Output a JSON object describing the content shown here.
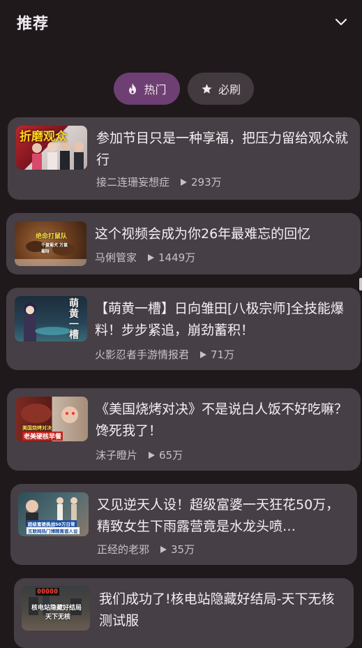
{
  "header": {
    "title": "推荐"
  },
  "tabs": [
    {
      "label": "热门",
      "icon": "flame-icon",
      "selected": true
    },
    {
      "label": "必刷",
      "icon": "star-icon",
      "selected": false
    }
  ],
  "videos": [
    {
      "title": "参加节目只是一种享福，把压力留给观众就行",
      "author": "接二连珊妄想症",
      "views": "293万",
      "thumb_text": "折磨观众"
    },
    {
      "title": "这个视频会成为你26年最难忘的回忆",
      "author": "马俐管家",
      "views": "1449万",
      "thumb_text": "绝命打鼠队",
      "thumb_sub": "千鼠蜀犬 万鼠蜀呀"
    },
    {
      "title": "【萌黄一槽】日向雏田[八极宗师]全技能爆料！步步紧追，崩劲蓄积！",
      "author": "火影忍者手游情报君",
      "views": "71万",
      "thumb_text": "萌黄一槽"
    },
    {
      "title": "《美国烧烤对决》不是说白人饭不好吃嘛？馋死我了！",
      "author": "沫子瞪片",
      "views": "65万",
      "thumb_text": "美国烧烤对决",
      "thumb_sub": "老美硬核早餐"
    },
    {
      "title": "又见逆天人设！超级富婆一天狂花50万，精致女生下雨露营竟是水龙头喷…",
      "author": "正经的老邪",
      "views": "35万",
      "thumb_text": "超级富婆挑战50万日常",
      "thumb_sub": "互联网热门博精离谱人设"
    },
    {
      "title": "我们成功了!核电站隐藏好结局-天下无核 测试服",
      "author": "",
      "views": "",
      "thumb_text": "核电站隐藏好结局",
      "thumb_sub": "天下无核",
      "thumb_counter": "00000"
    }
  ],
  "colors": {
    "background": "#1f191c",
    "card": "#473f46",
    "chip_selected": "#6e3f72",
    "chip": "#433a40"
  }
}
